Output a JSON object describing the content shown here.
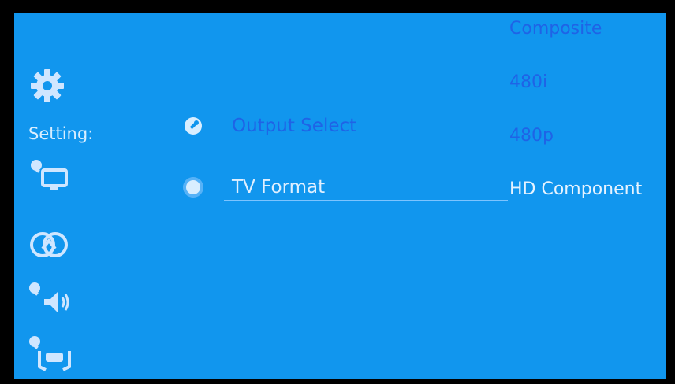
{
  "sidebar": {
    "title": "Setting:",
    "icons": [
      "gear-icon",
      "tv-settings-icon",
      "network-icon",
      "audio-settings-icon",
      "remote-settings-icon"
    ]
  },
  "menu": {
    "items": [
      {
        "label": "Output Select",
        "selected": false
      },
      {
        "label": "TV Format",
        "selected": true
      }
    ]
  },
  "options": {
    "items": [
      {
        "label": "Composite",
        "selected": false
      },
      {
        "label": "480i",
        "selected": false
      },
      {
        "label": "480p",
        "selected": false
      },
      {
        "label": "HD Component",
        "selected": true
      }
    ]
  },
  "colors": {
    "background": "#1196ee",
    "text_dim": "#1f63e6",
    "text_selected": "#e6f3ff",
    "frame": "#000000"
  }
}
